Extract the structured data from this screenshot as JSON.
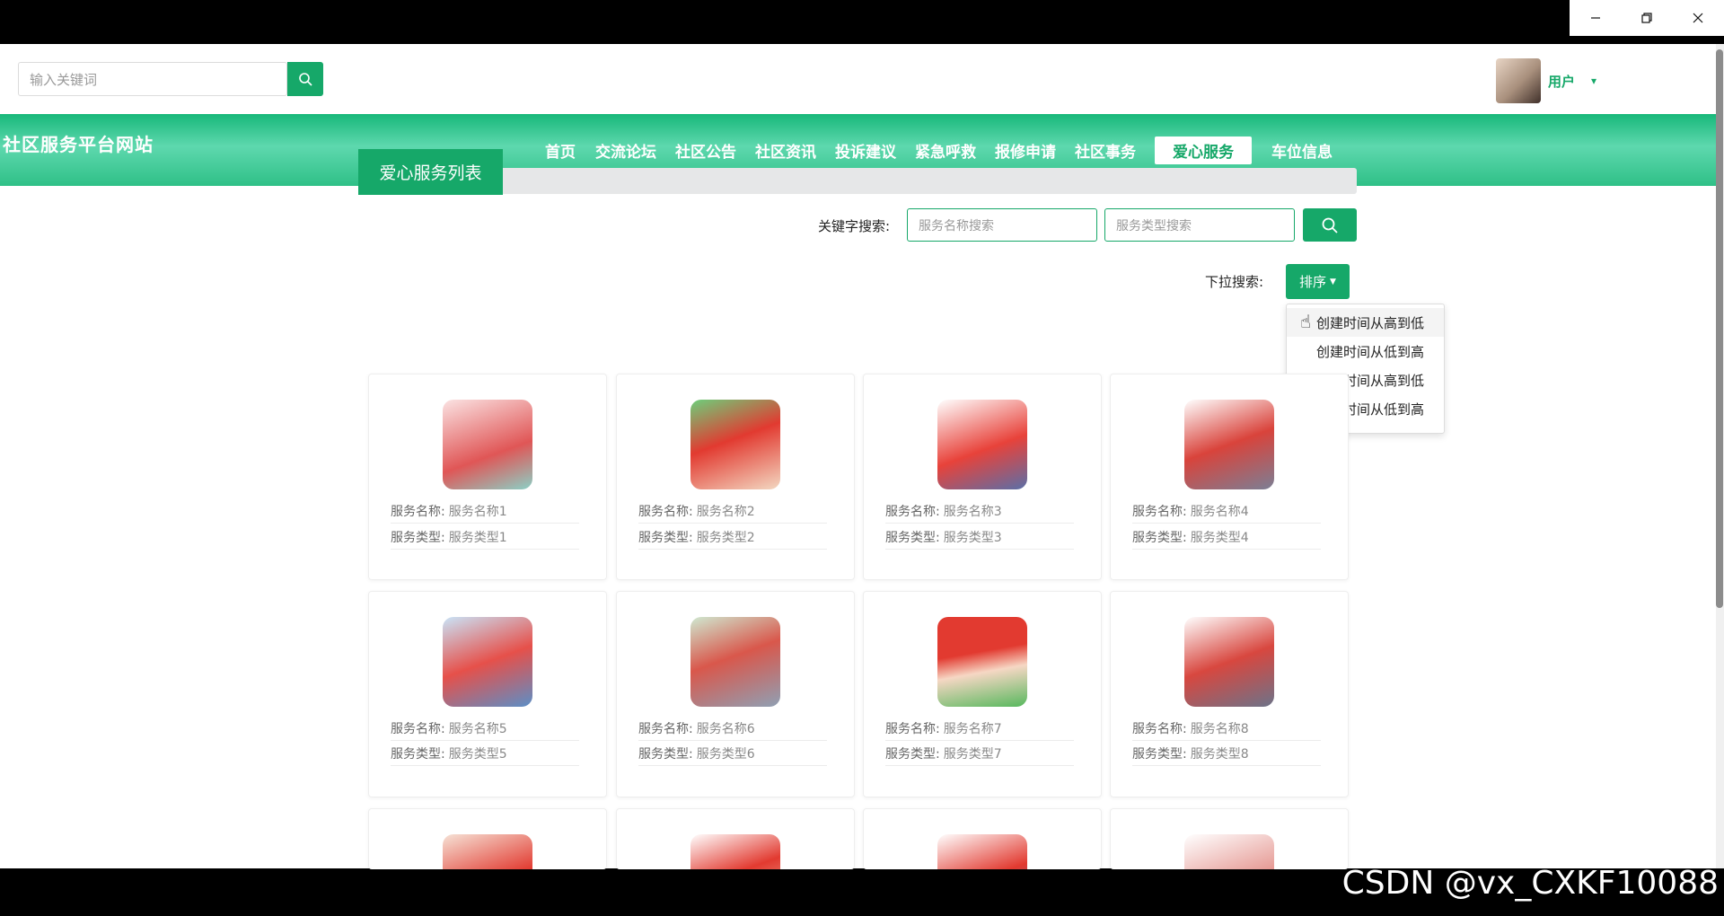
{
  "search": {
    "placeholder": "输入关键词"
  },
  "user": {
    "name": "用户",
    "caret": "▾"
  },
  "nav": {
    "brand": "社区服务平台网站",
    "items": [
      {
        "label": "首页"
      },
      {
        "label": "交流论坛"
      },
      {
        "label": "社区公告"
      },
      {
        "label": "社区资讯"
      },
      {
        "label": "投诉建议"
      },
      {
        "label": "紧急呼救"
      },
      {
        "label": "报修申请"
      },
      {
        "label": "社区事务"
      },
      {
        "label": "爱心服务"
      },
      {
        "label": "车位信息"
      }
    ]
  },
  "list": {
    "title": "爱心服务列表",
    "keyword_label": "关键字搜索:",
    "name_placeholder": "服务名称搜索",
    "type_placeholder": "服务类型搜索",
    "dropdown_label": "下拉搜索:",
    "sort_label": "排序",
    "sort_options": [
      "创建时间从高到低",
      "创建时间从低到高",
      "更新时间从高到低",
      "更新时间从低到高"
    ]
  },
  "cards": [
    {
      "name_key": "服务名称:",
      "name": "服务名称1",
      "type_key": "服务类型:",
      "type": "服务类型1"
    },
    {
      "name_key": "服务名称:",
      "name": "服务名称2",
      "type_key": "服务类型:",
      "type": "服务类型2"
    },
    {
      "name_key": "服务名称:",
      "name": "服务名称3",
      "type_key": "服务类型:",
      "type": "服务类型3"
    },
    {
      "name_key": "服务名称:",
      "name": "服务名称4",
      "type_key": "服务类型:",
      "type": "服务类型4"
    },
    {
      "name_key": "服务名称:",
      "name": "服务名称5",
      "type_key": "服务类型:",
      "type": "服务类型5"
    },
    {
      "name_key": "服务名称:",
      "name": "服务名称6",
      "type_key": "服务类型:",
      "type": "服务类型6"
    },
    {
      "name_key": "服务名称:",
      "name": "服务名称7",
      "type_key": "服务类型:",
      "type": "服务类型7"
    },
    {
      "name_key": "服务名称:",
      "name": "服务名称8",
      "type_key": "服务类型:",
      "type": "服务类型8"
    }
  ],
  "watermark": "CSDN @vx_CXKF10088",
  "colors": {
    "accent": "#16a869",
    "nav_light": "#5ed8ae"
  }
}
